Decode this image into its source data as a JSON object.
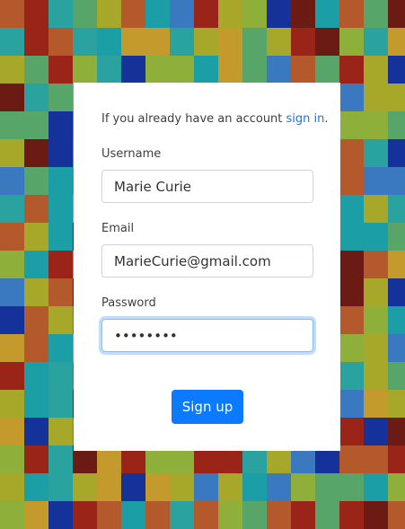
{
  "background": {
    "palette": [
      "#1b9ea6",
      "#2aa3a0",
      "#57a568",
      "#8faf3b",
      "#a7a72a",
      "#b3592b",
      "#9a2418",
      "#6b1b14",
      "#15329b",
      "#3a79c0",
      "#c39a2b"
    ]
  },
  "form": {
    "intro_text": "If you already have an account ",
    "intro_link": "sign in",
    "intro_suffix": ".",
    "username": {
      "label": "Username",
      "value": "Marie Curie"
    },
    "email": {
      "label": "Email",
      "value": "MarieCurie@gmail.com"
    },
    "password": {
      "label": "Password",
      "value": "••••••••"
    },
    "submit_label": "Sign up"
  }
}
